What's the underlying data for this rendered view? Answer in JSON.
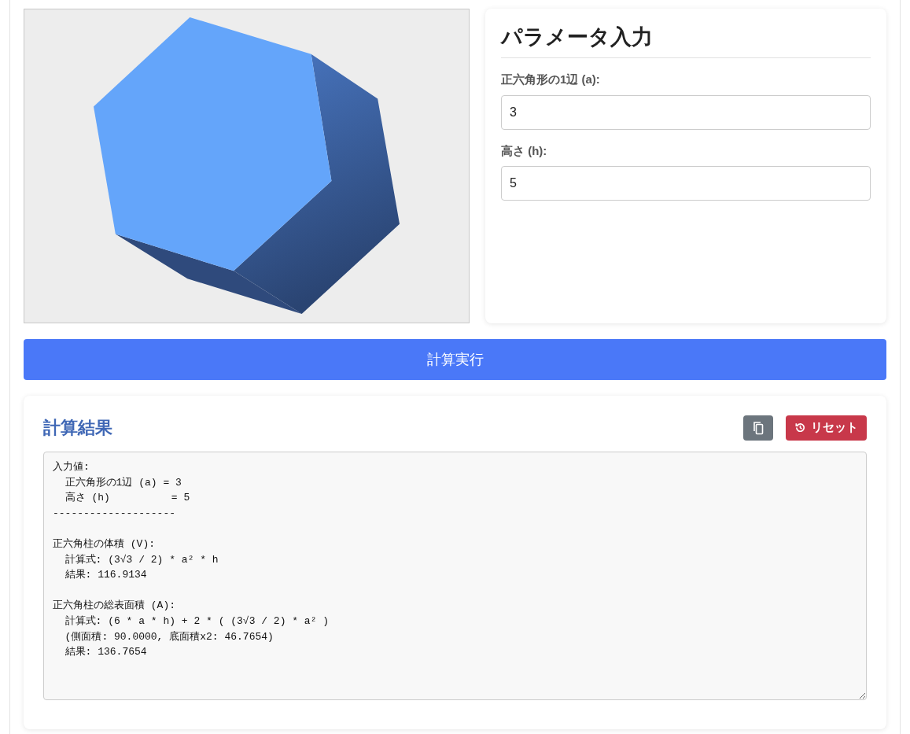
{
  "params": {
    "title": "パラメータ入力",
    "fields": [
      {
        "label": "正六角形の1辺 (a):",
        "value": "3"
      },
      {
        "label": "高さ (h):",
        "value": "5"
      }
    ]
  },
  "run_button": "計算実行",
  "results": {
    "title": "計算結果",
    "reset_button": "リセット",
    "blocks": [
      [
        "入力値:",
        "  正六角形の1辺 (a) = 3",
        "  高さ (h)          = 5",
        "--------------------"
      ],
      [
        "正六角柱の体積 (V):",
        "  計算式: (3√3 / 2) * a² * h",
        "  結果: 116.9134"
      ],
      [
        "正六角柱の総表面積 (A):",
        "  計算式: (6 * a * h) + 2 * ( (3√3 / 2) * a² )",
        "  (側面積: 90.0000, 底面積x2: 46.7654)",
        "  結果: 136.7654"
      ]
    ]
  }
}
